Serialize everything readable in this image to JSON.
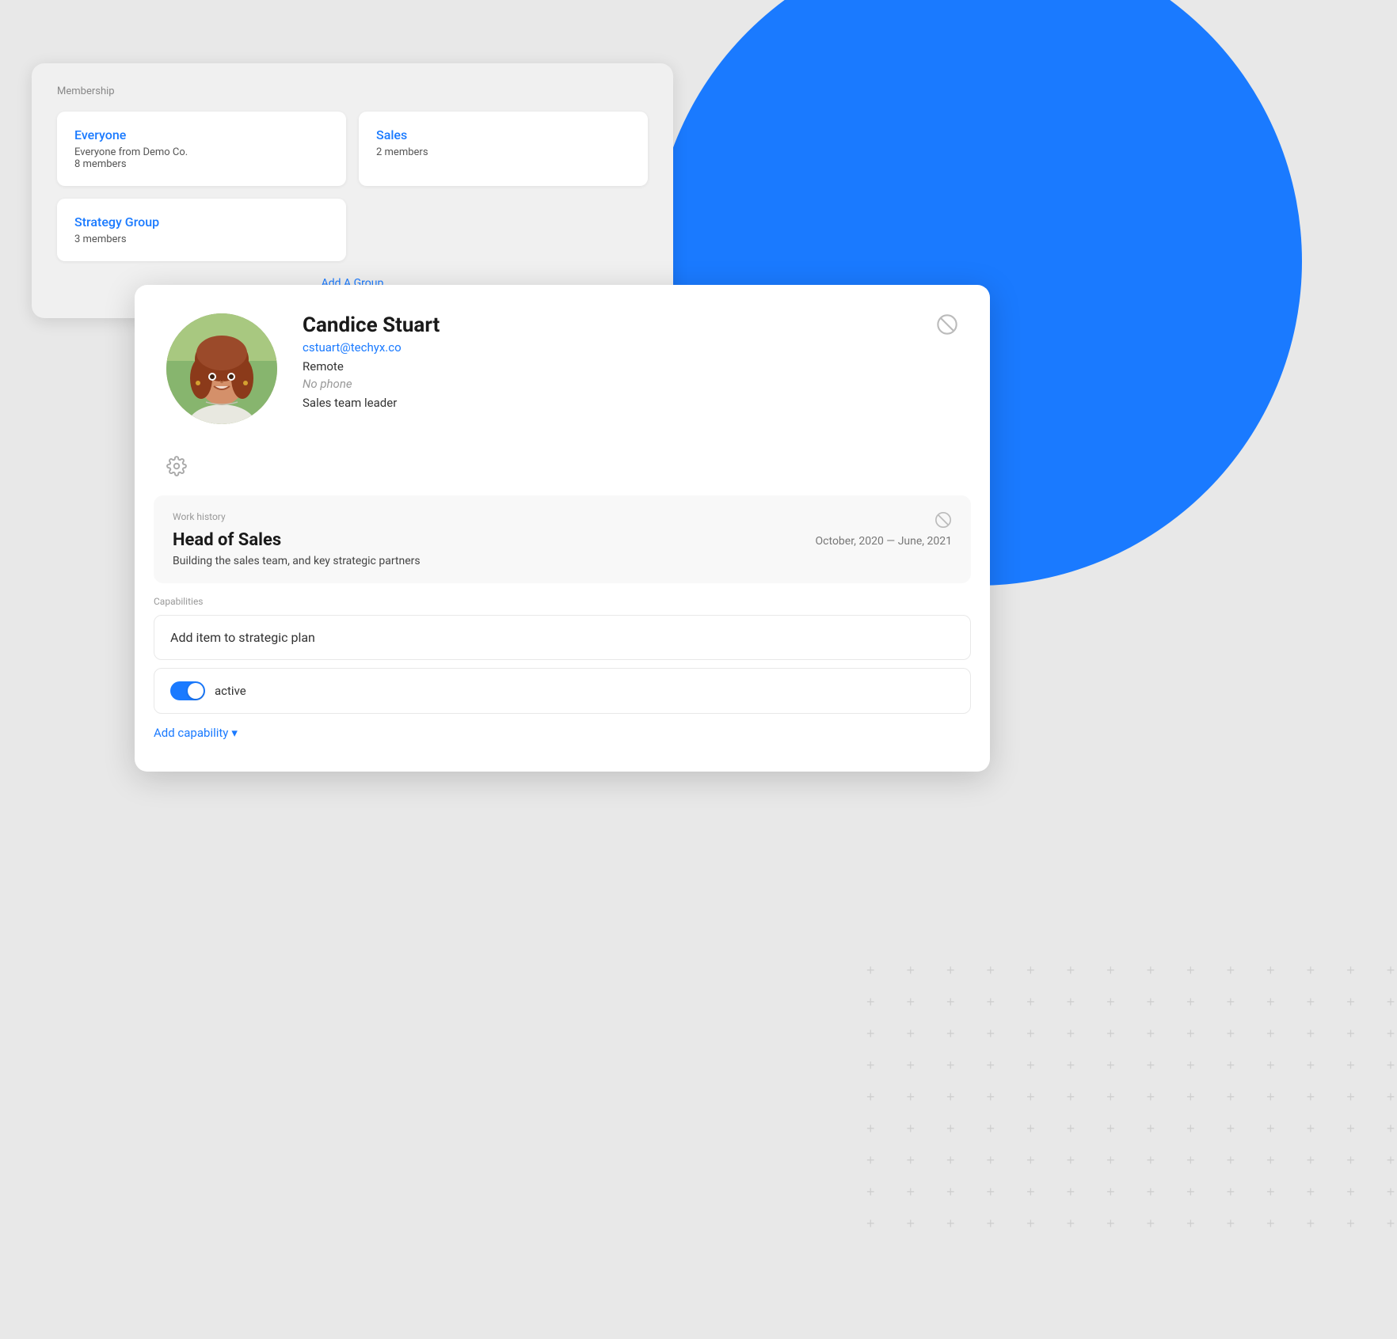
{
  "background": {
    "circle_color": "#1a7aff"
  },
  "membership_card": {
    "label": "Membership",
    "groups": [
      {
        "title": "Everyone",
        "subtitle": "Everyone from Demo Co.",
        "members": "8 members"
      },
      {
        "title": "Sales",
        "subtitle": "",
        "members": "2 members"
      },
      {
        "title": "Strategy Group",
        "subtitle": "",
        "members": "3 members"
      }
    ],
    "add_group_label": "Add A Group"
  },
  "profile": {
    "name": "Candice Stuart",
    "email": "cstuart@techyx.co",
    "location": "Remote",
    "phone": "No phone",
    "role": "Sales team leader"
  },
  "work_history": {
    "section_label": "Work history",
    "job_title": "Head of Sales",
    "dates": "October, 2020 — June, 2021",
    "description": "Building the sales team, and key strategic partners"
  },
  "capabilities": {
    "section_label": "Capabilities",
    "items": [
      {
        "text": "Add item to strategic plan"
      }
    ],
    "toggle": {
      "label": "active",
      "active": true
    },
    "add_label": "Add capability",
    "add_icon": "▾"
  }
}
